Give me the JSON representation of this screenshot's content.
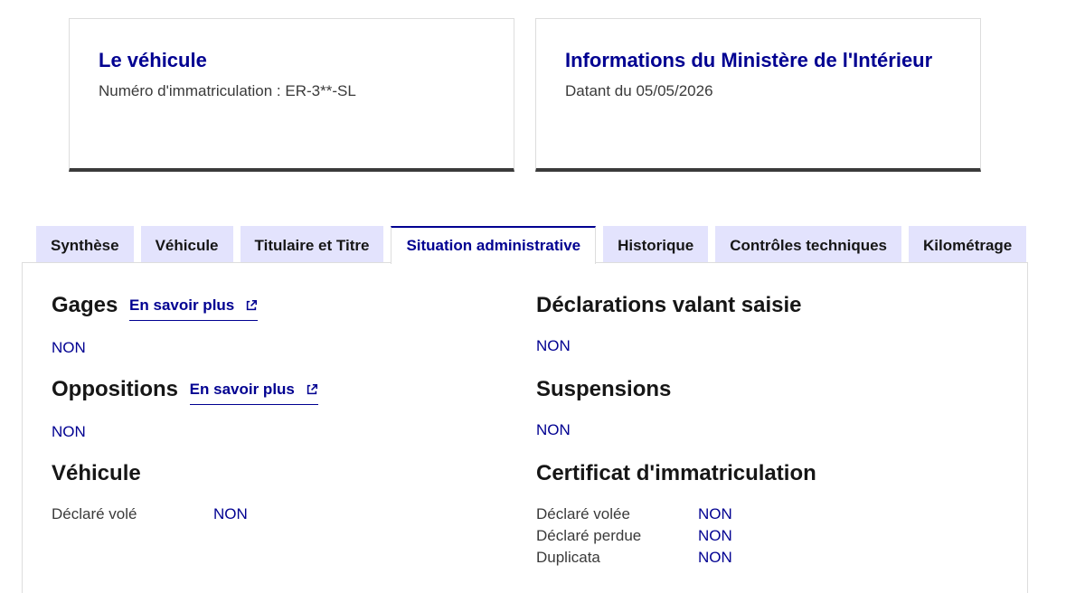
{
  "cards": {
    "vehicle": {
      "title": "Le véhicule",
      "text": "Numéro d'immatriculation : ER-3**-SL"
    },
    "ministry": {
      "title": "Informations du Ministère de l'Intérieur",
      "text": "Datant du 05/05/2026"
    }
  },
  "tabs": [
    {
      "label": "Synthèse"
    },
    {
      "label": "Véhicule"
    },
    {
      "label": "Titulaire et Titre"
    },
    {
      "label": "Situation administrative",
      "active": true
    },
    {
      "label": "Historique"
    },
    {
      "label": "Contrôles techniques"
    },
    {
      "label": "Kilométrage"
    }
  ],
  "panel": {
    "gages": {
      "title": "Gages",
      "link": "En savoir plus",
      "value": "NON"
    },
    "oppositions": {
      "title": "Oppositions",
      "link": "En savoir plus",
      "value": "NON"
    },
    "vehicule": {
      "title": "Véhicule",
      "rows": [
        {
          "label": "Déclaré volé",
          "value": "NON"
        }
      ]
    },
    "declarations": {
      "title": "Déclarations valant saisie",
      "value": "NON"
    },
    "suspensions": {
      "title": "Suspensions",
      "value": "NON"
    },
    "certificat": {
      "title": "Certificat d'immatriculation",
      "rows": [
        {
          "label": "Déclaré volée",
          "value": "NON"
        },
        {
          "label": "Déclaré perdue",
          "value": "NON"
        },
        {
          "label": "Duplicata",
          "value": "NON"
        }
      ]
    }
  },
  "icons": {
    "external_link": "external-link-icon"
  },
  "colors": {
    "accent": "#000091",
    "tab_bg": "#e3e3fd",
    "card_border": "#3a3a3a"
  }
}
